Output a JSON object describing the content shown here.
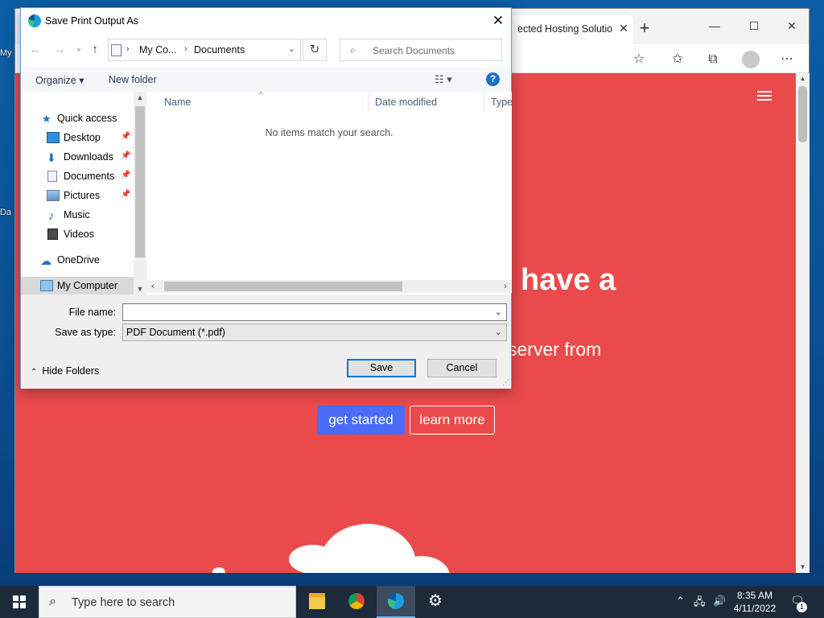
{
  "desktop": {
    "icon_labels": [
      "My",
      "Da"
    ]
  },
  "browser": {
    "tab_title": "ected Hosting Solution",
    "tab_close": "✕",
    "new_tab": "+",
    "window_controls": {
      "minimize": "—",
      "maximize": "☐",
      "close": "✕"
    },
    "toolbar_icons": [
      "favorite-add-icon",
      "favorites-icon",
      "collections-icon",
      "profile-icon",
      "more-icon"
    ],
    "page": {
      "hero_heading": "have a",
      "hero_sub": "server from",
      "btn_start": "get started",
      "btn_learn": "learn more",
      "bg_color": "#ea4a4c",
      "accent_color": "#4a6cf7"
    }
  },
  "dialog": {
    "title": "Save Print Output As",
    "close": "✕",
    "address": {
      "crumbs": [
        "My Co...",
        "Documents"
      ],
      "refresh": "↻"
    },
    "search_placeholder": "Search Documents",
    "commands": {
      "organize": "Organize ▾",
      "new_folder": "New folder",
      "view": "☷ ▾",
      "help": "?"
    },
    "nav_items": [
      {
        "label": "Quick access",
        "icon": "star-icon",
        "pinned": false
      },
      {
        "label": "Desktop",
        "icon": "desktop-icon",
        "pinned": true
      },
      {
        "label": "Downloads",
        "icon": "download-icon",
        "pinned": true
      },
      {
        "label": "Documents",
        "icon": "document-icon",
        "pinned": true
      },
      {
        "label": "Pictures",
        "icon": "pictures-icon",
        "pinned": true
      },
      {
        "label": "Music",
        "icon": "music-icon",
        "pinned": false
      },
      {
        "label": "Videos",
        "icon": "videos-icon",
        "pinned": false
      },
      {
        "label": "OneDrive",
        "icon": "cloud-icon",
        "pinned": false
      },
      {
        "label": "My Computer",
        "icon": "computer-icon",
        "pinned": false
      }
    ],
    "columns": [
      "Name",
      "Date modified",
      "Type"
    ],
    "empty_message": "No items match your search.",
    "file_name_label": "File name:",
    "file_name_value": "",
    "save_type_label": "Save as type:",
    "save_type_value": "PDF Document (*.pdf)",
    "hide_folders": "Hide Folders",
    "save_button": "Save",
    "cancel_button": "Cancel"
  },
  "taskbar": {
    "search_placeholder": "Type here to search",
    "apps": [
      "file-explorer-icon",
      "chrome-icon",
      "edge-icon",
      "settings-icon"
    ],
    "time": "8:35 AM",
    "date": "4/11/2022",
    "notification_count": "1"
  }
}
